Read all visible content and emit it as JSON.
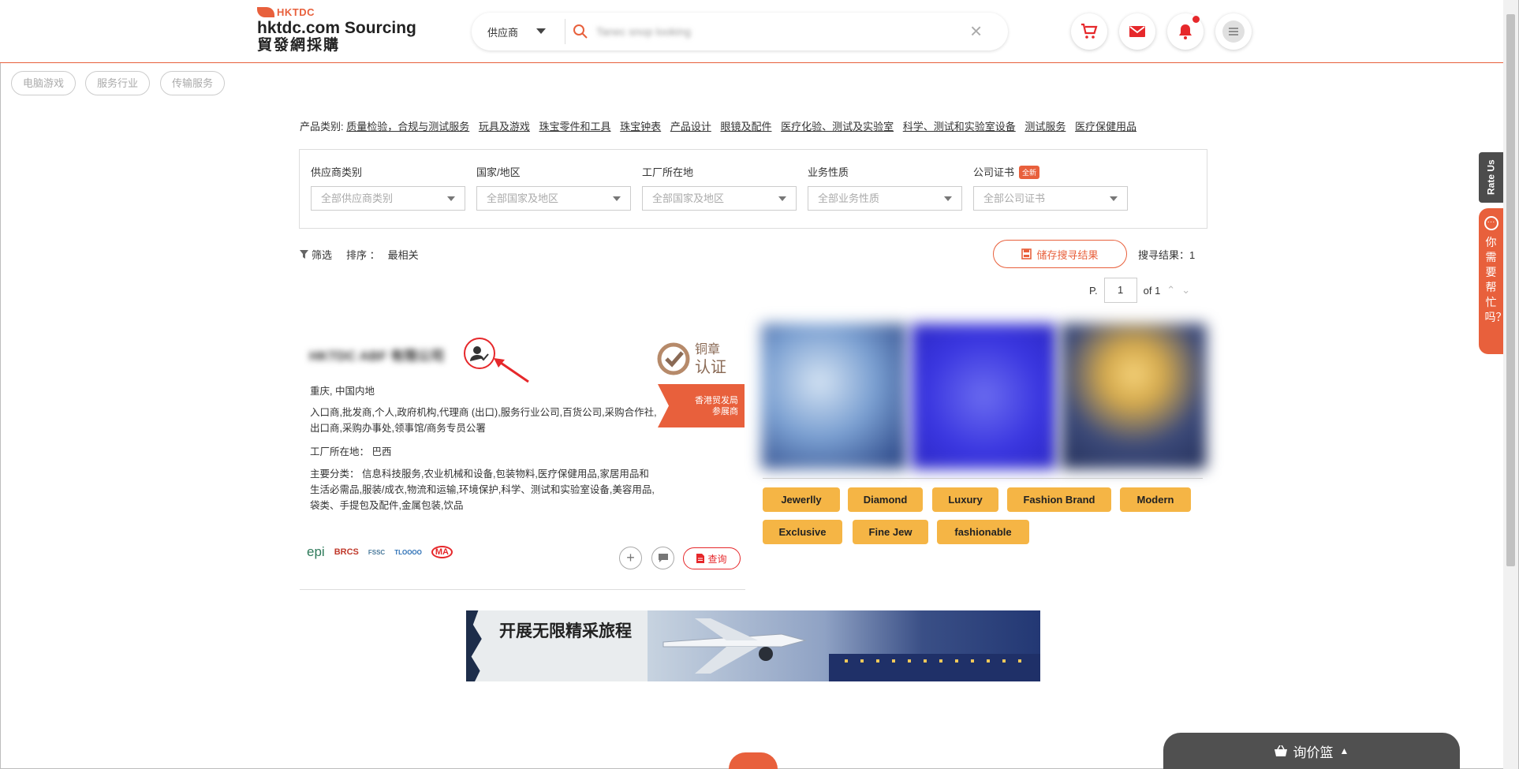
{
  "header": {
    "logo_brand": "HKTDC",
    "logo_title": "hktdc.com Sourcing",
    "logo_sub": "貿發網採購",
    "search_type": "供应商",
    "search_query": "Tanec snop looking",
    "clear_label": "×"
  },
  "chips": [
    "电脑游戏",
    "服务行业",
    "传输服务"
  ],
  "categories": {
    "label": "产品类别:",
    "items": [
      "质量检验，合规与测试服务",
      "玩具及游戏",
      "珠宝零件和工具",
      "珠宝钟表",
      "产品设计",
      "眼镜及配件",
      "医疗化验、测试及实验室",
      "科学、测试和实验室设备",
      "测试服务",
      "医疗保健用品"
    ]
  },
  "filters": [
    {
      "label": "供应商类别",
      "placeholder": "全部供应商类别",
      "badge": ""
    },
    {
      "label": "国家/地区",
      "placeholder": "全部国家及地区",
      "badge": ""
    },
    {
      "label": "工厂所在地",
      "placeholder": "全部国家及地区",
      "badge": ""
    },
    {
      "label": "业务性质",
      "placeholder": "全部业务性质",
      "badge": ""
    },
    {
      "label": "公司证书",
      "placeholder": "全部公司证书",
      "badge": "全新"
    }
  ],
  "toolbar": {
    "filter_label": "筛选",
    "sort_label": "排序 ：",
    "sort_value": "最相关",
    "save_label": "储存搜寻结果",
    "result_label": "搜寻结果：1"
  },
  "pager": {
    "prefix": "P.",
    "current": "1",
    "total": "of 1"
  },
  "supplier": {
    "name": "HKTDC ABF 有限公司",
    "badge_line1": "铜章",
    "badge_line2": "认证",
    "exhibitor_line1": "香港贸发局",
    "exhibitor_line2": "参展商",
    "location": "重庆, 中国内地",
    "business_types": "入口商,批发商,个人,政府机构,代理商 (出口),服务行业公司,百货公司,采购合作社,出口商,采购办事处,领事馆/商务专员公署",
    "factory": "工厂所在地： 巴西",
    "categories": "主要分类： 信息科技服务,农业机械和设备,包装物料,医疗保健用品,家居用品和生活必需品,服装/成衣,物流和运输,环境保护,科学、测试和实验室设备,美容用品,袋类、手提包及配件,金属包装,饮品",
    "cert_logos": [
      "epi",
      "BRCS",
      "FSSC",
      "TLOOOO",
      "MA"
    ],
    "enquire_label": "查询"
  },
  "tags": [
    "Jewerlly",
    "Diamond",
    "Luxury",
    "Fashion Brand",
    "Modern",
    "Exclusive",
    "Fine Jew",
    "fashionable"
  ],
  "banner": {
    "text": "开展无限精采旅程"
  },
  "side": {
    "rate_us": "Rate Us",
    "help": "你需要帮忙吗？"
  },
  "basket": {
    "label": "询价篮"
  },
  "colors": {
    "accent": "#e8603c",
    "tag": "#f5b545",
    "badge_red": "#e6282b"
  }
}
